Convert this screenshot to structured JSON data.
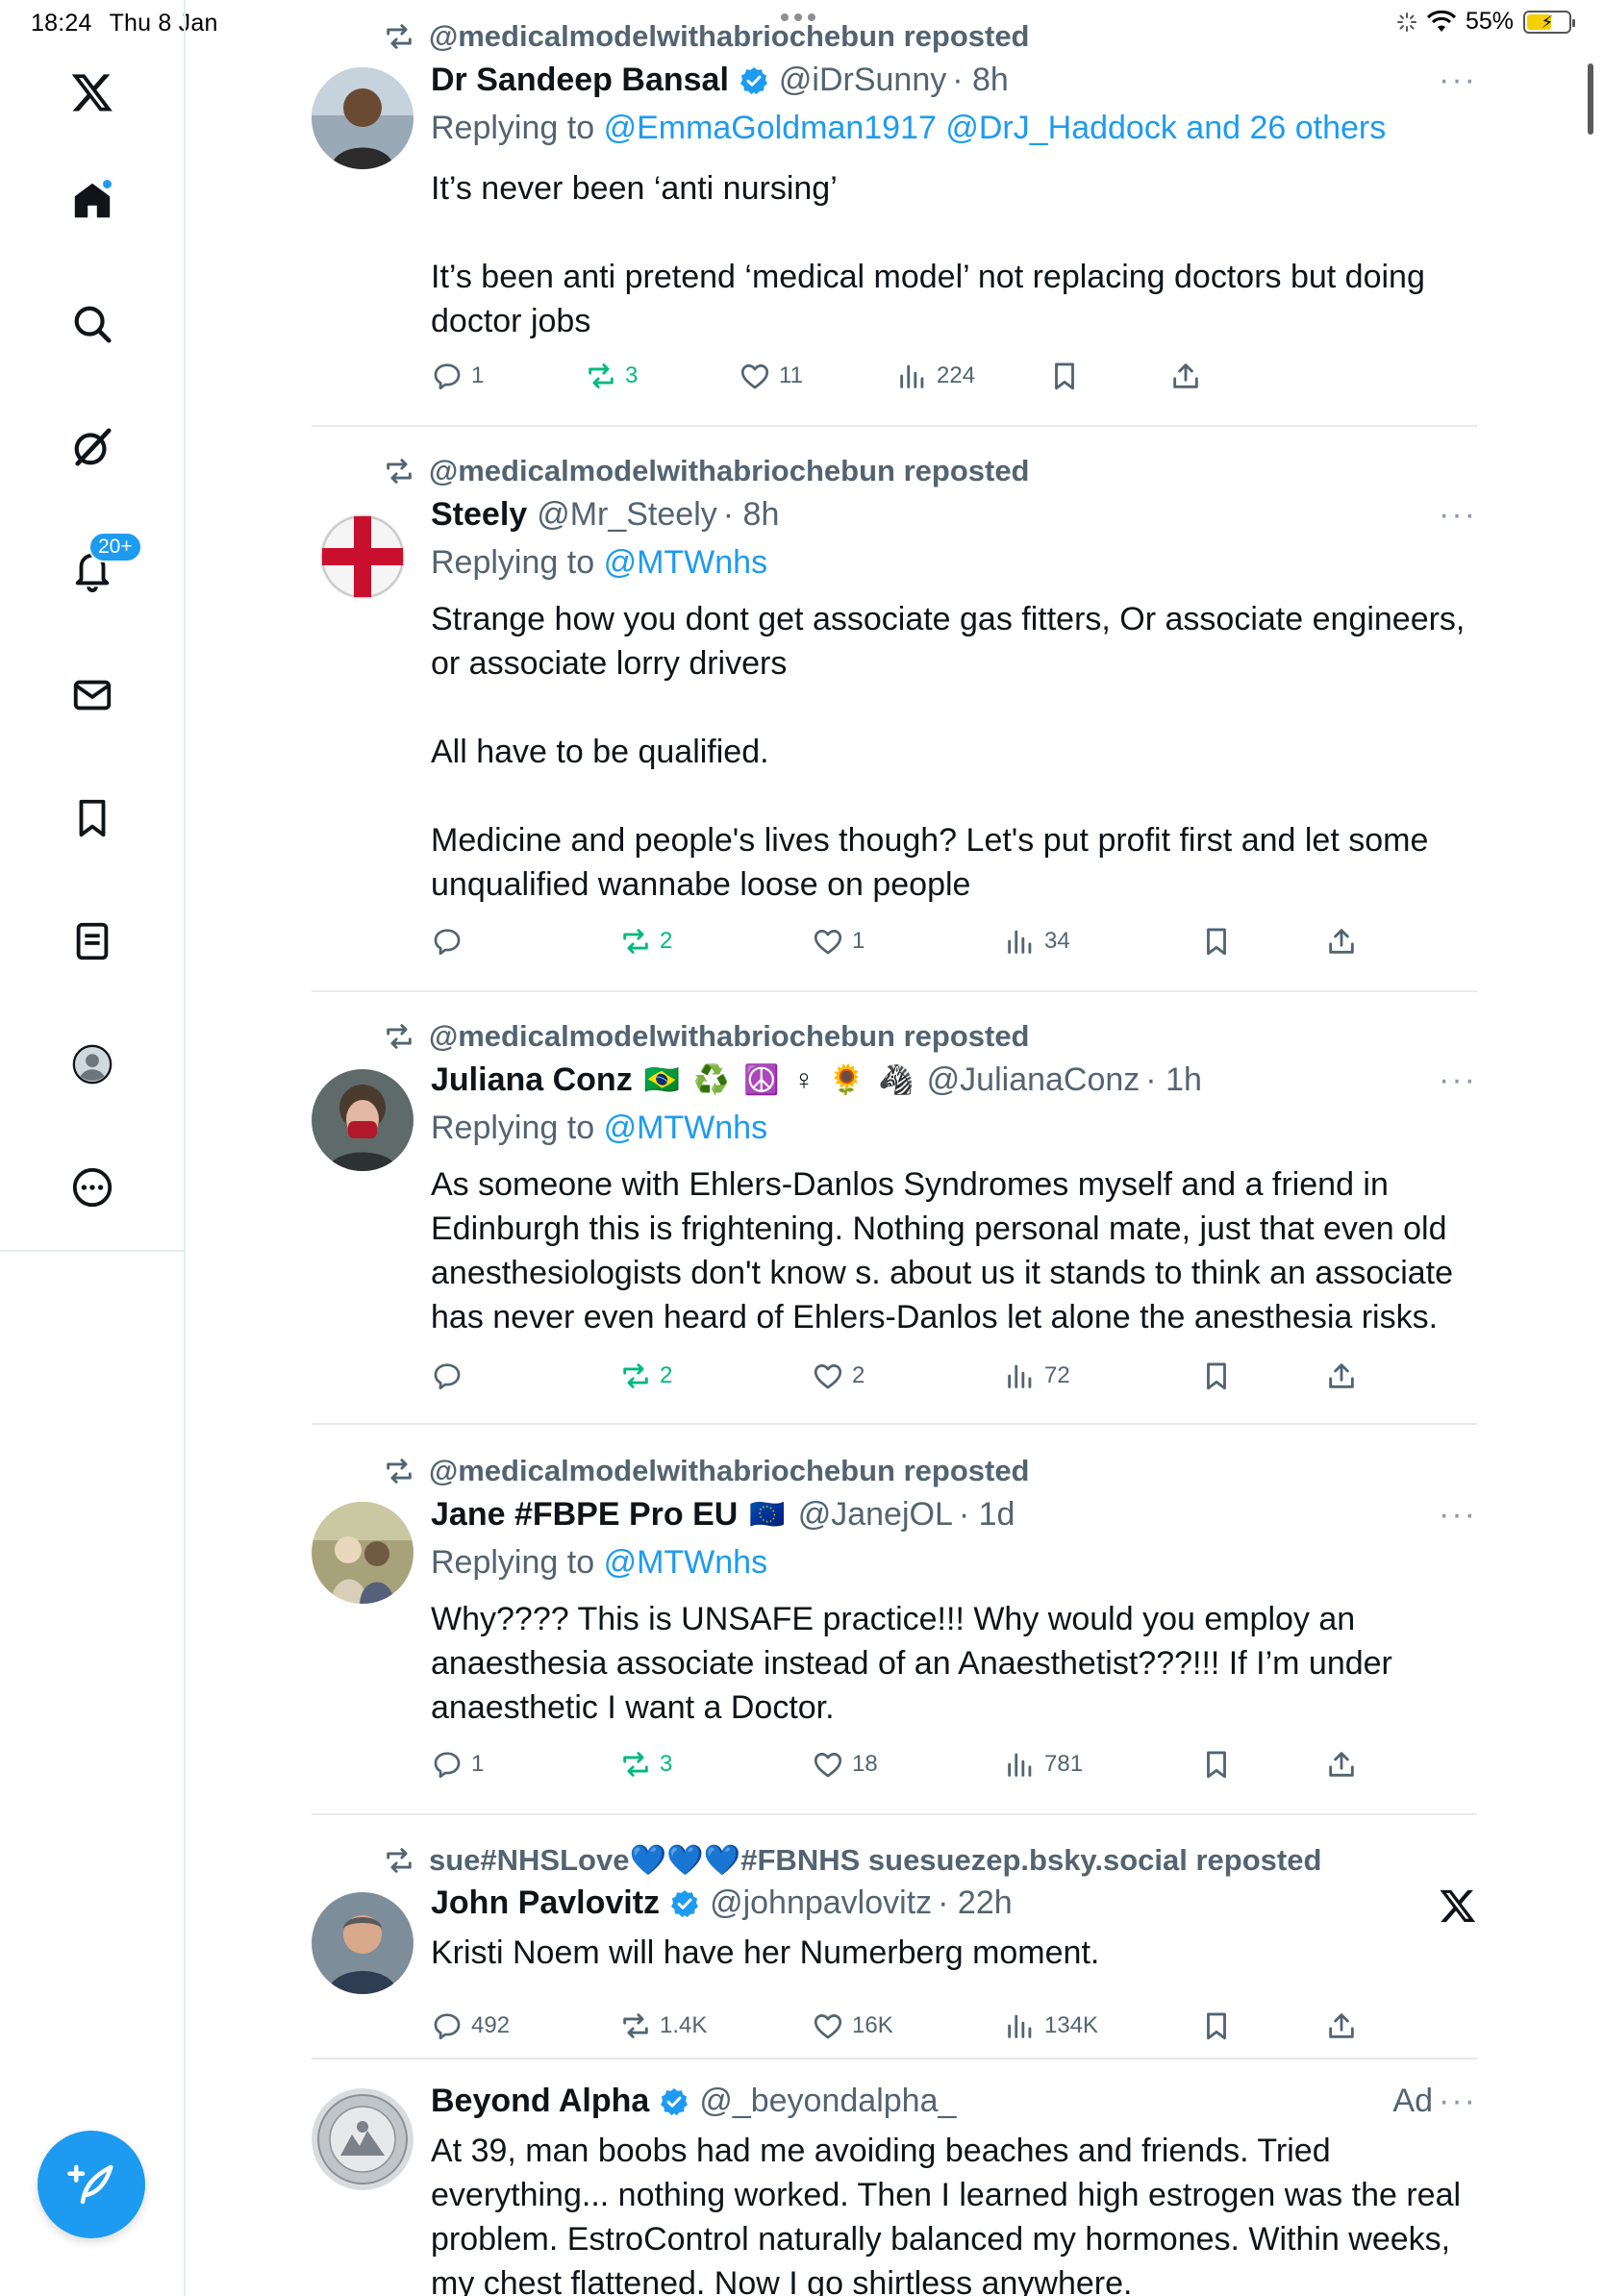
{
  "status_bar": {
    "time": "18:24",
    "date": "Thu 8 Jan",
    "battery": "55%"
  },
  "sidebar": {
    "items": [
      {
        "name": "logo-x-icon"
      },
      {
        "name": "home-icon"
      },
      {
        "name": "search-icon"
      },
      {
        "name": "grok-icon"
      },
      {
        "name": "notifications-icon",
        "badge": "20+"
      },
      {
        "name": "messages-icon"
      },
      {
        "name": "bookmarks-icon"
      },
      {
        "name": "lists-icon"
      },
      {
        "name": "profile-icon"
      },
      {
        "name": "more-icon"
      }
    ]
  },
  "compose": {
    "icon": "compose-feather-plus-icon"
  },
  "posts": [
    {
      "repost_by": "@medicalmodelwithabriochebun reposted",
      "name": "Dr Sandeep Bansal",
      "verified": true,
      "handle": "@iDrSunny",
      "time": "· 8h",
      "replying_prefix": "Replying to",
      "replying_to": "@EmmaGoldman1917 @DrJ_Haddock and 26 others",
      "body": [
        "It’s never been ‘anti nursing’",
        "It’s been anti pretend ‘medical model’ not replacing doctors but doing doctor jobs"
      ],
      "stats": {
        "replies": "1",
        "reposts": "3",
        "likes": "11",
        "views": "224"
      }
    },
    {
      "repost_by": "@medicalmodelwithabriochebun reposted",
      "name": "Steely",
      "verified": false,
      "handle": "@Mr_Steely",
      "time": "· 8h",
      "replying_prefix": "Replying to",
      "replying_to": "@MTWnhs",
      "body": [
        "Strange how you dont get associate gas fitters, Or associate engineers, or associate lorry drivers",
        "All have to be qualified.",
        "Medicine and people's lives though? Let's put profit first and let some unqualified wannabe loose on people"
      ],
      "stats": {
        "replies": "",
        "reposts": "2",
        "likes": "1",
        "views": "34"
      }
    },
    {
      "repost_by": "@medicalmodelwithabriochebun reposted",
      "name": "Juliana Conz",
      "flags": "🇧🇷 ♻️ ☮️ ♀ 🌻 🦓",
      "verified": false,
      "handle": "@JulianaConz",
      "time": "· 1h",
      "replying_prefix": "Replying to",
      "replying_to": "@MTWnhs",
      "body": [
        "As someone with Ehlers-Danlos Syndromes myself and a friend in Edinburgh this is  frightening. Nothing personal mate, just that even old anesthesiologists don't know s. about us it stands to think an associate has never even heard of Ehlers-Danlos let alone the anesthesia risks."
      ],
      "stats": {
        "replies": "",
        "reposts": "2",
        "likes": "2",
        "views": "72"
      }
    },
    {
      "repost_by": "@medicalmodelwithabriochebun reposted",
      "name": "Jane #FBPE Pro EU",
      "flags": "🇪🇺",
      "verified": false,
      "handle": "@JanejOL",
      "time": "· 1d",
      "replying_prefix": "Replying to",
      "replying_to": "@MTWnhs",
      "body": [
        "Why???? This is UNSAFE practice!!! Why would you employ an anaesthesia associate instead of an Anaesthetist???!!! If I’m under anaesthetic I want a Doctor."
      ],
      "stats": {
        "replies": "1",
        "reposts": "3",
        "likes": "18",
        "views": "781"
      }
    },
    {
      "repost_by": "sue#NHSLove💙💙💙#FBNHS suesuezep.bsky.social reposted",
      "name": "John Pavlovitz",
      "verified": true,
      "handle": "@johnpavlovitz",
      "time": "· 22h",
      "body": [
        "Kristi Noem will have her Numerberg moment."
      ],
      "stats": {
        "replies": "492",
        "reposts": "1.4K",
        "likes": "16K",
        "views": "134K"
      }
    },
    {
      "name": "Beyond Alpha",
      "verified": true,
      "handle": "@_beyondalpha_",
      "ad_label": "Ad",
      "body": [
        "At 39, man boobs had me avoiding beaches and friends. Tried everything... nothing worked. Then I learned high estrogen was the real problem. EstroControl naturally balanced my hormones. Within weeks, my chest flattened. Now I go shirtless anywhere."
      ]
    }
  ],
  "colors": {
    "accent": "#1d9bf0",
    "repost_green": "#00ba7c",
    "muted": "#536471"
  }
}
